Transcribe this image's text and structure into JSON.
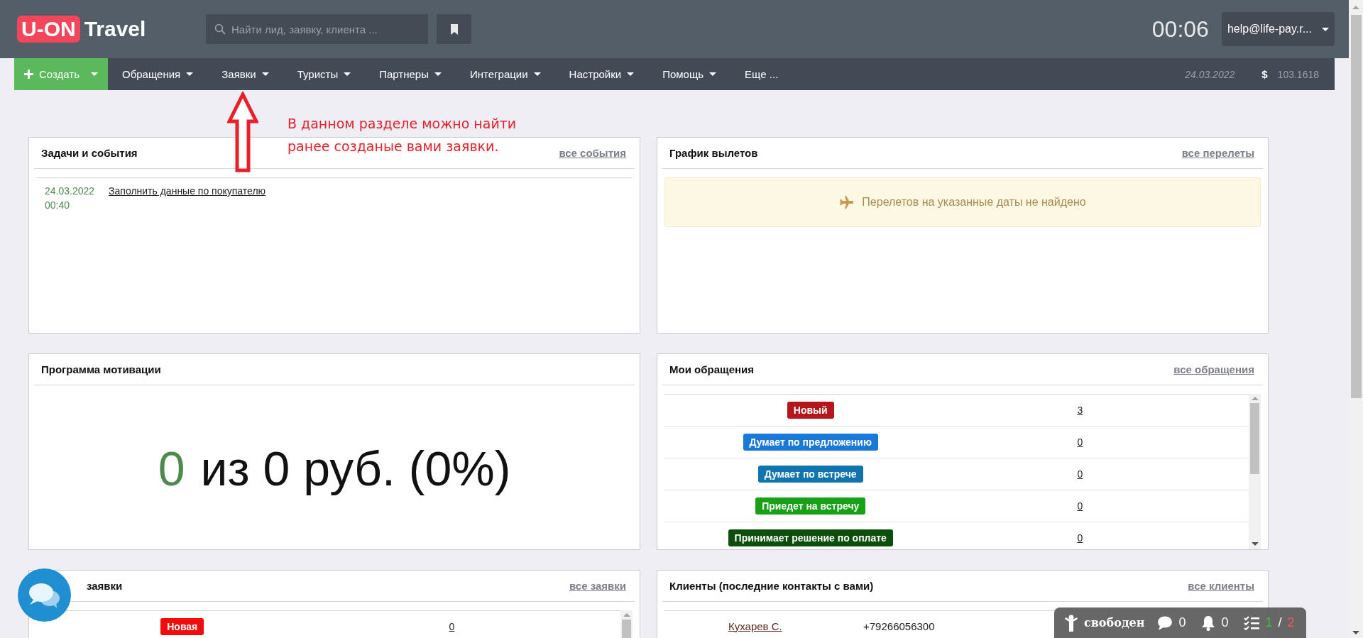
{
  "header": {
    "logo": {
      "badge": "U-ON",
      "word": "Travel"
    },
    "search": {
      "placeholder": "Найти лид, заявку, клиента ..."
    },
    "timer": "00:06",
    "user": "help@life-pay.r..."
  },
  "nav": {
    "create": "Создать",
    "items": [
      {
        "label": "Обращения",
        "has_menu": true
      },
      {
        "label": "Заявки",
        "has_menu": true
      },
      {
        "label": "Туристы",
        "has_menu": true
      },
      {
        "label": "Партнеры",
        "has_menu": true
      },
      {
        "label": "Интеграции",
        "has_menu": true
      },
      {
        "label": "Настройки",
        "has_menu": true
      },
      {
        "label": "Помощь",
        "has_menu": true
      },
      {
        "label": "Еще ...",
        "has_menu": false
      }
    ],
    "date": "24.03.2022",
    "currency": "$",
    "rate": "103.1618"
  },
  "annotation": {
    "lines": [
      "В данном разделе можно найти",
      "ранее созданые вами заявки."
    ]
  },
  "tasks": {
    "title": "Задачи и события",
    "link": "все события",
    "events": [
      {
        "date": "24.03.2022",
        "time": "00:40",
        "title": "Заполнить данные по покупателю"
      }
    ]
  },
  "flights": {
    "title": "График вылетов",
    "link": "все перелеты",
    "notice": "Перелетов на указанные даты не найдено"
  },
  "motivation": {
    "title": "Программа мотивации",
    "achieved": "0",
    "rest": "из 0 руб. (0%)"
  },
  "appeals": {
    "title": "Мои обращения",
    "link": "все обращения",
    "rows": [
      {
        "status": "Новый",
        "color": "#b3161b",
        "count": "3"
      },
      {
        "status": "Думает по предложению",
        "color": "#1a78d8",
        "count": "0"
      },
      {
        "status": "Думает по встрече",
        "color": "#0f74b0",
        "count": "0"
      },
      {
        "status": "Приедет на встречу",
        "color": "#16a116",
        "count": "0"
      },
      {
        "status": "Принимает решение по оплате",
        "color": "#0b4f0b",
        "count": "0"
      }
    ]
  },
  "orders": {
    "title": "заявки",
    "link": "все заявки",
    "rows": [
      {
        "status": "Новая",
        "color": "#f20d0d",
        "count": "0"
      }
    ]
  },
  "clients": {
    "title": "Клиенты (последние контакты с вами)",
    "link": "все клиенты",
    "rows": [
      {
        "name": "Кухарев С.",
        "phone": "+79266056300"
      }
    ]
  },
  "status_widget": {
    "status": "свободен",
    "messages": "0",
    "notifications": "0",
    "tasks_done": "1",
    "tasks_separator": "/",
    "tasks_total": "2"
  }
}
